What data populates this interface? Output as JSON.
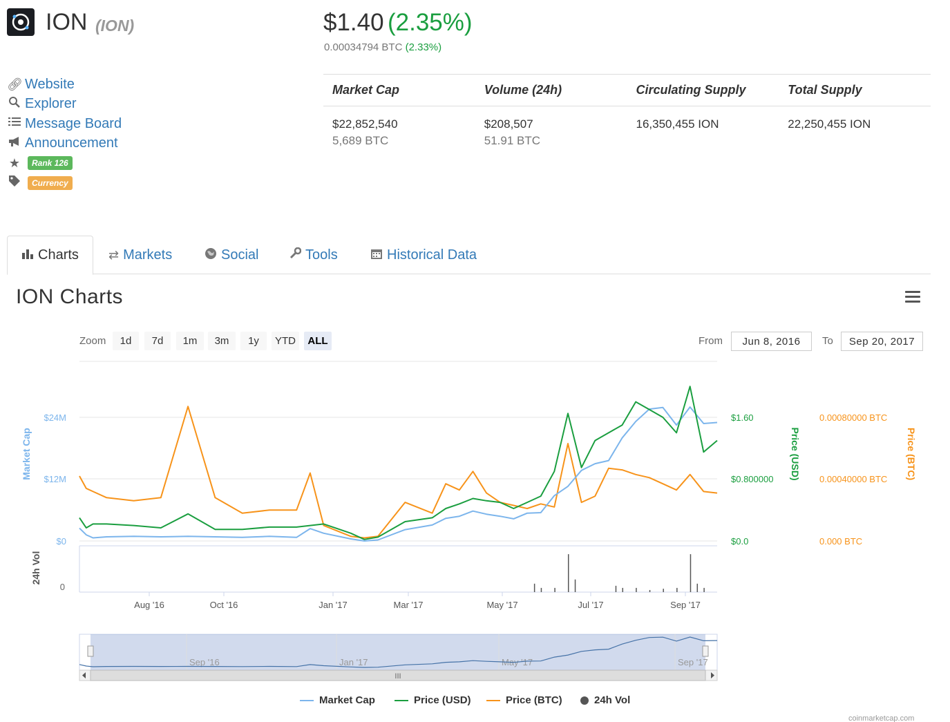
{
  "coin": {
    "name": "ION",
    "symbol": "(ION)",
    "price_usd": "$1.40",
    "change_usd": "(2.35%)",
    "price_btc": "0.00034794 BTC",
    "change_btc": "(2.33%)"
  },
  "links": [
    {
      "label": "Website",
      "icon": "link-icon"
    },
    {
      "label": "Explorer",
      "icon": "search-icon"
    },
    {
      "label": "Message Board",
      "icon": "list-icon"
    },
    {
      "label": "Announcement",
      "icon": "bullhorn-icon"
    }
  ],
  "badges": {
    "rank": "Rank 126",
    "type": "Currency"
  },
  "stats": {
    "headers": [
      "Market Cap",
      "Volume (24h)",
      "Circulating Supply",
      "Total Supply"
    ],
    "values": [
      {
        "primary": "$22,852,540",
        "secondary": "5,689 BTC"
      },
      {
        "primary": "$208,507",
        "secondary": "51.91 BTC"
      },
      {
        "primary": "16,350,455 ION",
        "secondary": ""
      },
      {
        "primary": "22,250,455 ION",
        "secondary": ""
      }
    ]
  },
  "tabs": [
    {
      "label": "Charts",
      "icon": "bar-chart-icon",
      "active": true
    },
    {
      "label": "Markets",
      "icon": "exchange-icon"
    },
    {
      "label": "Social",
      "icon": "globe-icon"
    },
    {
      "label": "Tools",
      "icon": "wrench-icon"
    },
    {
      "label": "Historical Data",
      "icon": "calendar-icon"
    }
  ],
  "chart_header": {
    "title": "ION Charts",
    "zoom_label": "Zoom",
    "zoom_options": [
      "1d",
      "7d",
      "1m",
      "3m",
      "1y",
      "YTD",
      "ALL"
    ],
    "zoom_selected": "ALL",
    "from_label": "From",
    "from_value": "Jun 8, 2016",
    "to_label": "To",
    "to_value": "Sep 20, 2017"
  },
  "credits": "coinmarketcap.com",
  "chart_data": {
    "type": "line",
    "x_ticks": [
      "Aug '16",
      "Oct '16",
      "Jan '17",
      "Mar '17",
      "May '17",
      "Jul '17",
      "Sep '17"
    ],
    "navigator_ticks": [
      "Sep '16",
      "Jan '17",
      "May '17",
      "Sep '17"
    ],
    "y_axes": [
      {
        "label": "Market Cap",
        "ticks": [
          "$0",
          "$12M",
          "$24M"
        ],
        "range": [
          0,
          24000000
        ],
        "color": "#7cb5ec"
      },
      {
        "label": "Price (USD)",
        "ticks": [
          "$0.0",
          "$0.800000",
          "$1.60"
        ],
        "range": [
          0,
          1.6
        ],
        "color": "#1a9e3f"
      },
      {
        "label": "Price (BTC)",
        "ticks": [
          "0.000 BTC",
          "0.00040000 BTC",
          "0.00080000 BTC"
        ],
        "range": [
          0,
          0.0008
        ],
        "color": "#f7931a"
      },
      {
        "label": "24h Vol",
        "ticks": [
          "0"
        ],
        "color": "#555555"
      }
    ],
    "x_range": [
      "Jun 8, 2016",
      "Sep 20, 2017"
    ],
    "series": [
      {
        "name": "Market Cap",
        "color": "#7cb5ec",
        "x": [
          0,
          5,
          10,
          20,
          40,
          60,
          80,
          100,
          120,
          140,
          160,
          170,
          180,
          200,
          210,
          220,
          240,
          260,
          270,
          280,
          290,
          300,
          310,
          320,
          330,
          340,
          350,
          360,
          370,
          380,
          390,
          400,
          410,
          420,
          430,
          440,
          450,
          460,
          470
        ],
        "values": [
          2500000,
          1200000,
          600000,
          800000,
          900000,
          800000,
          900000,
          800000,
          700000,
          900000,
          700000,
          2400000,
          1500000,
          400000,
          0,
          200000,
          2200000,
          3100000,
          4400000,
          4800000,
          5800000,
          5200000,
          4800000,
          4300000,
          5400000,
          5500000,
          8800000,
          10600000,
          13700000,
          15000000,
          15600000,
          20000000,
          23200000,
          25600000,
          25900000,
          22500000,
          26000000,
          22800000,
          23000000
        ]
      },
      {
        "name": "Price (USD)",
        "color": "#1a9e3f",
        "x": [
          0,
          5,
          10,
          20,
          40,
          60,
          80,
          100,
          120,
          140,
          160,
          170,
          180,
          200,
          210,
          220,
          240,
          260,
          270,
          280,
          290,
          300,
          310,
          320,
          330,
          340,
          350,
          360,
          370,
          380,
          390,
          400,
          410,
          420,
          430,
          440,
          450,
          460,
          470
        ],
        "values": [
          0.3,
          0.17,
          0.22,
          0.22,
          0.2,
          0.17,
          0.35,
          0.15,
          0.15,
          0.18,
          0.18,
          0.2,
          0.22,
          0.1,
          0.02,
          0.05,
          0.25,
          0.3,
          0.42,
          0.48,
          0.55,
          0.52,
          0.5,
          0.42,
          0.5,
          0.58,
          0.9,
          1.65,
          0.95,
          1.3,
          1.4,
          1.5,
          1.8,
          1.7,
          1.6,
          1.4,
          2.0,
          1.15,
          1.3
        ]
      },
      {
        "name": "Price (BTC)",
        "color": "#f7931a",
        "x": [
          0,
          5,
          10,
          20,
          40,
          60,
          80,
          100,
          120,
          140,
          160,
          170,
          180,
          200,
          210,
          220,
          240,
          260,
          270,
          280,
          290,
          300,
          310,
          320,
          330,
          340,
          350,
          360,
          370,
          380,
          390,
          400,
          410,
          420,
          430,
          440,
          450,
          460,
          470
        ],
        "values": [
          0.00042,
          0.00034,
          0.00032,
          0.00028,
          0.00026,
          0.00028,
          0.00087,
          0.00028,
          0.00018,
          0.0002,
          0.0002,
          0.00044,
          0.0001,
          3e-05,
          2e-05,
          3e-05,
          0.00025,
          0.00018,
          0.00037,
          0.00033,
          0.00045,
          0.00031,
          0.00025,
          0.00023,
          0.00021,
          0.00024,
          0.00022,
          0.00063,
          0.00025,
          0.00029,
          0.00047,
          0.00046,
          0.00043,
          0.00041,
          0.00037,
          0.00033,
          0.00043,
          0.00032,
          0.00031
        ]
      },
      {
        "name": "24h Vol",
        "x": [
          335,
          340,
          350,
          360,
          365,
          395,
          400,
          410,
          420,
          430,
          440,
          450,
          455,
          460
        ],
        "values": [
          0.2,
          0.1,
          0.1,
          0.9,
          0.3,
          0.15,
          0.1,
          0.1,
          0.05,
          0.08,
          0.1,
          0.9,
          0.2,
          0.1
        ]
      }
    ],
    "legend": [
      "Market Cap",
      "Price (USD)",
      "Price (BTC)",
      "24h Vol"
    ]
  }
}
